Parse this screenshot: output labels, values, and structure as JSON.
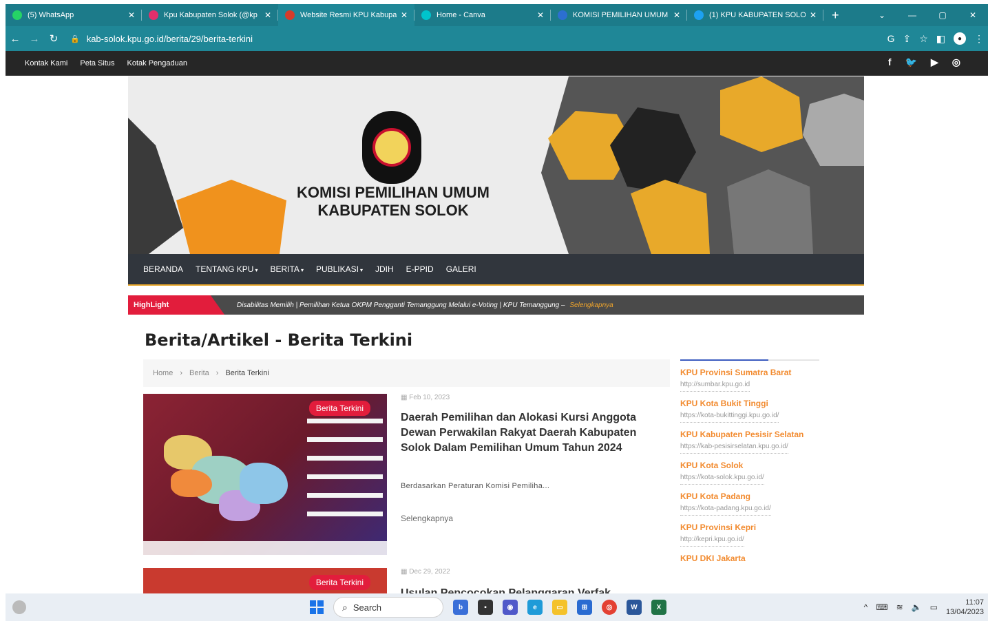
{
  "browser": {
    "tabs": [
      {
        "title": "(5) WhatsApp",
        "color": "#25d366",
        "active": false
      },
      {
        "title": "Kpu Kabupaten Solok (@kp",
        "color": "#e1306c",
        "active": false
      },
      {
        "title": "Website Resmi KPU Kabupa",
        "color": "#d43b2a",
        "active": true
      },
      {
        "title": "Home - Canva",
        "color": "#00c4cc",
        "active": false
      },
      {
        "title": "KOMISI PEMILIHAN UMUM",
        "color": "#2c6fd1",
        "active": false
      },
      {
        "title": "(1) KPU KABUPATEN SOLOK",
        "color": "#1da1f2",
        "active": false
      }
    ],
    "url": "kab-solok.kpu.go.id/berita/29/berita-terkini"
  },
  "topbar": {
    "links": [
      "Kontak Kami",
      "Peta Situs",
      "Kotak Pengaduan"
    ],
    "social_icons": [
      "facebook-icon",
      "twitter-icon",
      "youtube-icon",
      "instagram-icon"
    ]
  },
  "banner": {
    "logo_text": "KOMISI",
    "title_line1": "KOMISI PEMILIHAN UMUM",
    "title_line2": "KABUPATEN SOLOK"
  },
  "nav": {
    "items": [
      {
        "label": "BERANDA",
        "dropdown": false
      },
      {
        "label": "TENTANG KPU",
        "dropdown": true
      },
      {
        "label": "BERITA",
        "dropdown": true
      },
      {
        "label": "PUBLIKASI",
        "dropdown": true
      },
      {
        "label": "JDIH",
        "dropdown": false
      },
      {
        "label": "E-PPID",
        "dropdown": false
      },
      {
        "label": "GALERI",
        "dropdown": false
      }
    ]
  },
  "highlight": {
    "label": "HighLight",
    "text": "Disabilitas Memilih | Pemilihan Ketua OKPM Pengganti Temanggung Melalui e-Voting | KPU Temanggung –",
    "more": "Selengkapnya"
  },
  "page": {
    "title": "Berita/Artikel - Berita Terkini",
    "breadcrumb": [
      "Home",
      "Berita",
      "Berita Terkini"
    ]
  },
  "posts": [
    {
      "badge": "Berita Terkini",
      "date": "Feb 10, 2023",
      "headline": "Daerah Pemilihan dan Alokasi Kursi Anggota Dewan Perwakilan Rakyat Daerah Kabupaten Solok Dalam Pemilihan Umum Tahun 2024",
      "excerpt": "Berdasarkan Peraturan Komisi Pemiliha...",
      "readmore": "Selengkapnya"
    },
    {
      "badge": "Berita Terkini",
      "date": "Dec 29, 2022",
      "headline": "Usulan Pencocokan Pelanggaran Verfak",
      "excerpt": "",
      "readmore": ""
    }
  ],
  "sidebar": {
    "links": [
      {
        "name": "KPU Provinsi Sumatra Barat",
        "url": "http://sumbar.kpu.go.id"
      },
      {
        "name": "KPU Kota Bukit Tinggi",
        "url": "https://kota-bukittinggi.kpu.go.id/"
      },
      {
        "name": "KPU Kabupaten Pesisir Selatan",
        "url": "https://kab-pesisirselatan.kpu.go.id/"
      },
      {
        "name": "KPU Kota Solok",
        "url": "https://kota-solok.kpu.go.id/"
      },
      {
        "name": "KPU Kota Padang",
        "url": "https://kota-padang.kpu.go.id/"
      },
      {
        "name": "KPU Provinsi Kepri",
        "url": "http://kepri.kpu.go.id/"
      },
      {
        "name": "KPU DKI Jakarta",
        "url": ""
      }
    ]
  },
  "taskbar": {
    "search": "Search",
    "time": "11:07",
    "date": "13/04/2023"
  }
}
